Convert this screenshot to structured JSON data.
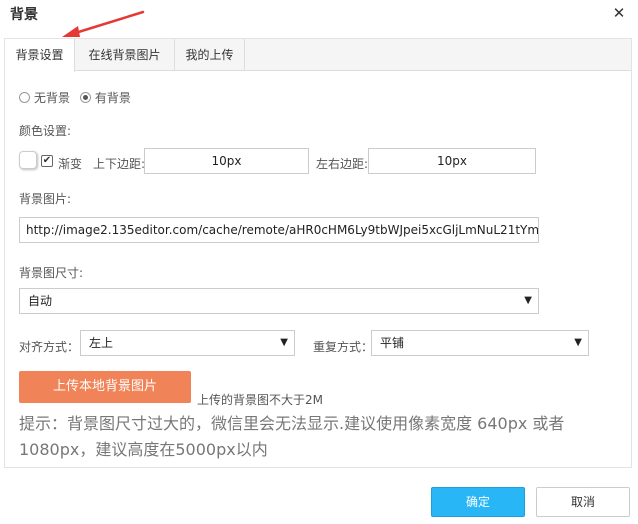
{
  "dialog": {
    "title": "背景",
    "close_icon": "close-icon"
  },
  "tabs": [
    {
      "label": "背景设置",
      "active": true
    },
    {
      "label": "在线背景图片",
      "active": false
    },
    {
      "label": "我的上传",
      "active": false
    }
  ],
  "background_mode": {
    "options": [
      {
        "label": "无背景",
        "checked": false
      },
      {
        "label": "有背景",
        "checked": true
      }
    ]
  },
  "color_settings": {
    "label": "颜色设置:",
    "gradient_label": "渐变",
    "gradient_checked": true,
    "vertical_margin_label": "上下边距:",
    "vertical_margin_value": "10px",
    "horizontal_margin_label": "左右边距:",
    "horizontal_margin_value": "10px"
  },
  "background_image": {
    "label": "背景图片:",
    "url": "http://image2.135editor.com/cache/remote/aHR0cHM6Ly9tbWJpei5xcGljLmNuL21tYm"
  },
  "image_size": {
    "label": "背景图尺寸:",
    "selected": "自动"
  },
  "alignment": {
    "label": "对齐方式：",
    "selected": "左上"
  },
  "repeat": {
    "label": "重复方式：",
    "selected": "平铺"
  },
  "upload": {
    "button_label": "上传本地背景图片",
    "note": "上传的背景图不大于2M"
  },
  "hint": "提示：背景图尺寸过大的，微信里会无法显示.建议使用像素宽度 640px 或者 1080px，建议高度在5000px以内",
  "footer": {
    "ok_label": "确定",
    "cancel_label": "取消"
  },
  "colors": {
    "accent": "#29b6f6",
    "upload": "#f08357",
    "arrow": "#e53935"
  }
}
